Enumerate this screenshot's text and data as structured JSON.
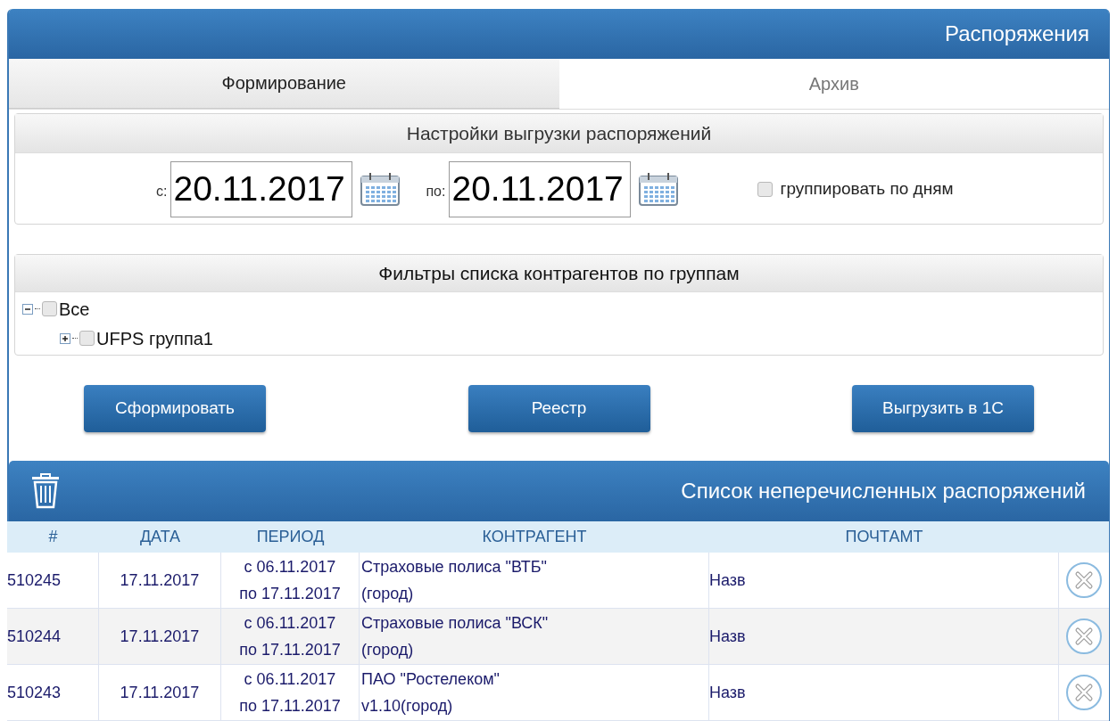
{
  "header": {
    "title": "Распоряжения"
  },
  "tabs": [
    {
      "label": "Формирование",
      "selected": true
    },
    {
      "label": "Архив",
      "selected": false
    }
  ],
  "settings": {
    "title": "Настройки выгрузки распоряжений",
    "from_label": "с:",
    "from_value": "20.11.2017",
    "to_label": "по:",
    "to_value": "20.11.2017",
    "group_by_days": {
      "label": "группировать по дням",
      "checked": false
    }
  },
  "filters": {
    "title": "Фильтры списка контрагентов по группам",
    "tree": [
      {
        "label": "Все",
        "checked": false,
        "expanded": true,
        "children": [
          {
            "label": "UFPS группа1",
            "checked": false,
            "expanded": false
          }
        ]
      }
    ]
  },
  "buttons": [
    "Сформировать",
    "Реестр",
    "Выгрузить в 1С"
  ],
  "list": {
    "title": "Список неперечисленных распоряжений",
    "columns": [
      "#",
      "ДАТА",
      "ПЕРИОД",
      "КОНТРАГЕНТ",
      "ПОЧТАМТ"
    ],
    "rows": [
      {
        "number": "510245",
        "date": "17.11.2017",
        "period": "с 06.11.2017 по 17.11.2017",
        "counterparty": "Страховые полиса \"ВТБ\" (город)",
        "post_office": "Назв"
      },
      {
        "number": "510244",
        "date": "17.11.2017",
        "period": "с 06.11.2017 по 17.11.2017",
        "counterparty": "Страховые полиса \"ВСК\" (город)",
        "post_office": "Назв"
      },
      {
        "number": "510243",
        "date": "17.11.2017",
        "period": "с 06.11.2017 по 17.11.2017",
        "counterparty": "ПАО \"Ростелеком\" v1.10(город)",
        "post_office": "Назв"
      }
    ]
  }
}
